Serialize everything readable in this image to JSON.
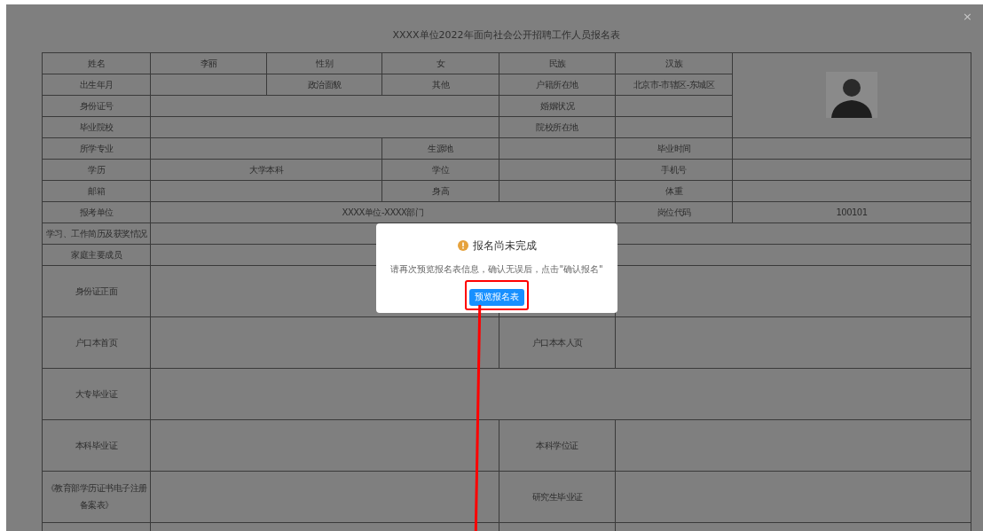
{
  "dialog": {
    "title": "XXXX单位2022年面向社会公开招聘工作人员报名表",
    "close": "×"
  },
  "form": {
    "rows": [
      {
        "kind": "short",
        "cells": [
          {
            "kind": "text",
            "text": "姓名"
          },
          {
            "kind": "text",
            "text": "李丽"
          },
          {
            "kind": "text",
            "text": "性别"
          },
          {
            "kind": "text",
            "text": "女"
          },
          {
            "kind": "text",
            "text": "民族"
          },
          {
            "kind": "text",
            "text": "汉族"
          },
          {
            "kind": "photo"
          }
        ]
      },
      {
        "kind": "short",
        "cells": [
          {
            "kind": "text",
            "text": "出生年月"
          },
          {
            "kind": "blank"
          },
          {
            "kind": "text",
            "text": "政治面貌"
          },
          {
            "kind": "text",
            "text": "其他"
          },
          {
            "kind": "text",
            "text": "户籍所在地"
          },
          {
            "kind": "text",
            "text": "北京市-市辖区-东城区"
          }
        ]
      },
      {
        "kind": "short",
        "cells": [
          {
            "kind": "text",
            "text": "身份证号"
          },
          {
            "kind": "blank"
          },
          {
            "kind": "text",
            "text": "婚姻状况"
          },
          {
            "kind": "blank"
          }
        ]
      },
      {
        "kind": "short",
        "cells": [
          {
            "kind": "text",
            "text": "毕业院校"
          },
          {
            "kind": "blank"
          },
          {
            "kind": "text",
            "text": "院校所在地"
          },
          {
            "kind": "blank"
          }
        ]
      },
      {
        "kind": "short",
        "cells": [
          {
            "kind": "text",
            "text": "所学专业"
          },
          {
            "kind": "blank"
          },
          {
            "kind": "text",
            "text": "生源地"
          },
          {
            "kind": "blank"
          },
          {
            "kind": "text",
            "text": "毕业时间"
          },
          {
            "kind": "blank"
          }
        ]
      },
      {
        "kind": "short",
        "cells": [
          {
            "kind": "text",
            "text": "学历"
          },
          {
            "kind": "text",
            "text": "大学本科"
          },
          {
            "kind": "text",
            "text": "学位"
          },
          {
            "kind": "blank"
          },
          {
            "kind": "text",
            "text": "手机号"
          },
          {
            "kind": "blank"
          }
        ]
      },
      {
        "kind": "short",
        "cells": [
          {
            "kind": "text",
            "text": "邮箱"
          },
          {
            "kind": "blank"
          },
          {
            "kind": "text",
            "text": "身高"
          },
          {
            "kind": "blank"
          },
          {
            "kind": "text",
            "text": "体重"
          },
          {
            "kind": "blank"
          }
        ]
      },
      {
        "kind": "short",
        "cells": [
          {
            "kind": "text",
            "text": "报考单位"
          },
          {
            "kind": "text",
            "text": "XXXX单位-XXXX部门",
            "colspan": 4
          },
          {
            "kind": "text",
            "text": "岗位代码"
          },
          {
            "kind": "text",
            "text": "100101"
          }
        ]
      },
      {
        "kind": "short",
        "cells": [
          {
            "kind": "text",
            "text": "学习、工作简历及获奖情况"
          },
          {
            "kind": "blank"
          }
        ]
      },
      {
        "kind": "short",
        "cells": [
          {
            "kind": "text",
            "text": "家庭主要成员"
          },
          {
            "kind": "blank"
          }
        ]
      },
      {
        "kind": "tall",
        "cells": [
          {
            "kind": "text",
            "text": "身份证正面"
          },
          {
            "kind": "blank"
          },
          {
            "kind": "blank"
          },
          {
            "kind": "blank"
          }
        ]
      },
      {
        "kind": "tall",
        "cells": [
          {
            "kind": "text",
            "text": "户口本首页"
          },
          {
            "kind": "blank"
          },
          {
            "kind": "text",
            "text": "户口本本人页"
          },
          {
            "kind": "blank"
          }
        ]
      },
      {
        "kind": "tall",
        "cells": [
          {
            "kind": "text",
            "text": "大专毕业证"
          },
          {
            "kind": "blank"
          }
        ]
      },
      {
        "kind": "tall",
        "cells": [
          {
            "kind": "text",
            "text": "本科毕业证"
          },
          {
            "kind": "blank"
          },
          {
            "kind": "text",
            "text": "本科学位证"
          },
          {
            "kind": "blank"
          }
        ]
      },
      {
        "kind": "tall",
        "cells": [
          {
            "kind": "text",
            "text": "《教育部学历证书电子注册备案表》"
          },
          {
            "kind": "blank"
          },
          {
            "kind": "text",
            "text": "研究生毕业证"
          },
          {
            "kind": "blank"
          }
        ]
      },
      {
        "kind": "tall",
        "cells": [
          {
            "kind": "blank"
          },
          {
            "kind": "blank"
          },
          {
            "kind": "blank"
          },
          {
            "kind": "blank"
          }
        ]
      }
    ]
  },
  "notice": {
    "title": "报名尚未完成",
    "message": "请再次预览报名表信息，确认无误后，点击\"确认报名\"",
    "button": "预览报名表"
  }
}
